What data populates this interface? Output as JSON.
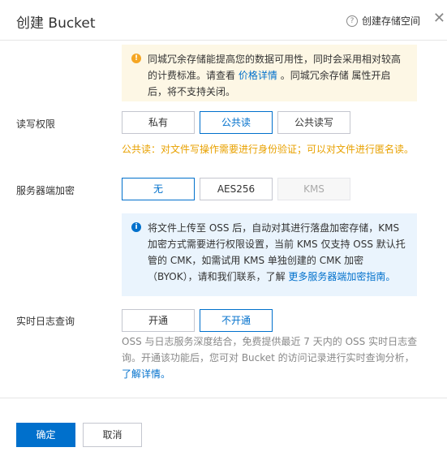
{
  "header": {
    "title": "创建 Bucket",
    "help_label": "创建存储空间",
    "close_icon": "close-icon"
  },
  "redundancy_notice": {
    "text_before": "同城冗余存储能提高您的数据可用性，同时会采用相对较高的计费标准。请查看",
    "link": "价格详情",
    "text_after": "。同城冗余存储 属性开启后，将不支持关闭。"
  },
  "acl": {
    "label": "读写权限",
    "options": [
      "私有",
      "公共读",
      "公共读写"
    ],
    "selected": "公共读",
    "warning": "公共读：对文件写操作需要进行身份验证；可以对文件进行匿名读。"
  },
  "encryption": {
    "label": "服务器端加密",
    "options": [
      "无",
      "AES256",
      "KMS"
    ],
    "selected": "无",
    "disabled": "KMS",
    "notice_text": "将文件上传至 OSS 后，自动对其进行落盘加密存储，KMS 加密方式需要进行权限设置，当前 KMS 仅支持 OSS 默认托管的 CMK，如需试用 KMS 单独创建的 CMK 加密（BYOK），请和我们联系，了解",
    "notice_link": "更多服务器端加密指南。"
  },
  "log_query": {
    "label": "实时日志查询",
    "options": [
      "开通",
      "不开通"
    ],
    "selected": "不开通",
    "description": "OSS 与日志服务深度结合，免费提供最近 7 天内的 OSS 实时日志查询。开通该功能后，您可对 Bucket 的访问记录进行实时查询分析，",
    "link": "了解详情。"
  },
  "footer": {
    "confirm_label": "确定",
    "cancel_label": "取消"
  },
  "colors": {
    "primary": "#0070cc",
    "warning_text": "#e8a100",
    "warning_bg": "#fdf7e5",
    "info_bg": "#eaf4fd"
  }
}
